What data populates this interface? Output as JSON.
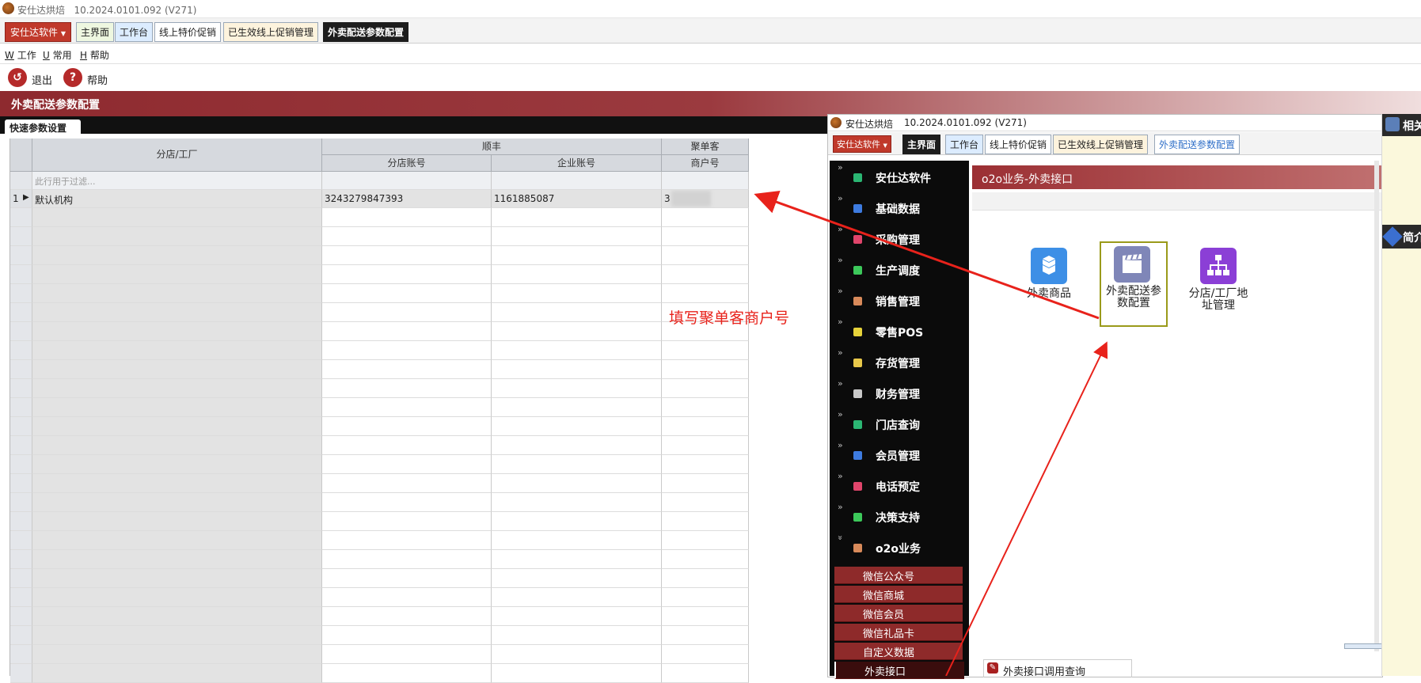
{
  "window": {
    "title": "安仕达烘焙",
    "version": "10.2024.0101.092 (V271)"
  },
  "brand_button": "安仕达软件",
  "tabs": [
    "主界面",
    "工作台",
    "线上特价促销",
    "已生效线上促销管理",
    "外卖配送参数配置"
  ],
  "menu": [
    "工作",
    "常用",
    "帮助"
  ],
  "menu_keys": [
    "W",
    "U",
    "H"
  ],
  "toolbar": {
    "exit_label": "退出",
    "help_label": "帮助"
  },
  "page_title": "外卖配送参数配置",
  "section_tab": "快速参数设置",
  "grid": {
    "col_store": "分店/工厂",
    "group_sf": "顺丰",
    "col_store_account": "分店账号",
    "col_company_account": "企业账号",
    "group_jdk": "聚单客",
    "col_merchant_no": "商户号",
    "filter_placeholder": "此行用于过滤...",
    "rows": [
      {
        "index": "1",
        "store": "默认机构",
        "store_account": "3243279847393",
        "company_account": "1161885087",
        "merchant_no": "3"
      }
    ]
  },
  "annotation": "填写聚单客商户号",
  "embedded": {
    "title": "安仕达烘焙",
    "version": "10.2024.0101.092 (V271)",
    "brand_button": "安仕达软件",
    "tabs": [
      "主界面",
      "工作台",
      "线上特价促销",
      "已生效线上促销管理",
      "外卖配送参数配置"
    ],
    "sidebar": [
      {
        "label": "安仕达软件",
        "color": "#2bb673"
      },
      {
        "label": "基础数据",
        "color": "#3d7be0"
      },
      {
        "label": "采购管理",
        "color": "#e0456b"
      },
      {
        "label": "生产调度",
        "color": "#3cc85a"
      },
      {
        "label": "销售管理",
        "color": "#d88a5a"
      },
      {
        "label": "零售POS",
        "color": "#e6d23a"
      },
      {
        "label": "存货管理",
        "color": "#e8c84a"
      },
      {
        "label": "财务管理",
        "color": "#c9c9c9"
      },
      {
        "label": "门店查询",
        "color": "#2bb673"
      },
      {
        "label": "会员管理",
        "color": "#3d7be0"
      },
      {
        "label": "电话预定",
        "color": "#e0456b"
      },
      {
        "label": "决策支持",
        "color": "#3cc85a"
      },
      {
        "label": "o2o业务",
        "color": "#d88a5a"
      }
    ],
    "subitems": [
      "微信公众号",
      "微信商城",
      "微信会员",
      "微信礼品卡",
      "自定义数据",
      "外卖接口"
    ],
    "panel_title": "o2o业务-外卖接口",
    "icons": [
      {
        "label": "外卖商品",
        "icon": "cubes-icon",
        "color": "#3d8fe6"
      },
      {
        "label": "外卖配送参数配置",
        "icon": "clapperboard-icon",
        "color": "#7f86b8"
      },
      {
        "label": "分店/工厂地址管理",
        "icon": "sitemap-icon",
        "color": "#8b3fd6"
      }
    ],
    "bottom_link": "外卖接口调用查询"
  },
  "right_edge": {
    "top_label": "相关",
    "bottom_label": "简介"
  }
}
